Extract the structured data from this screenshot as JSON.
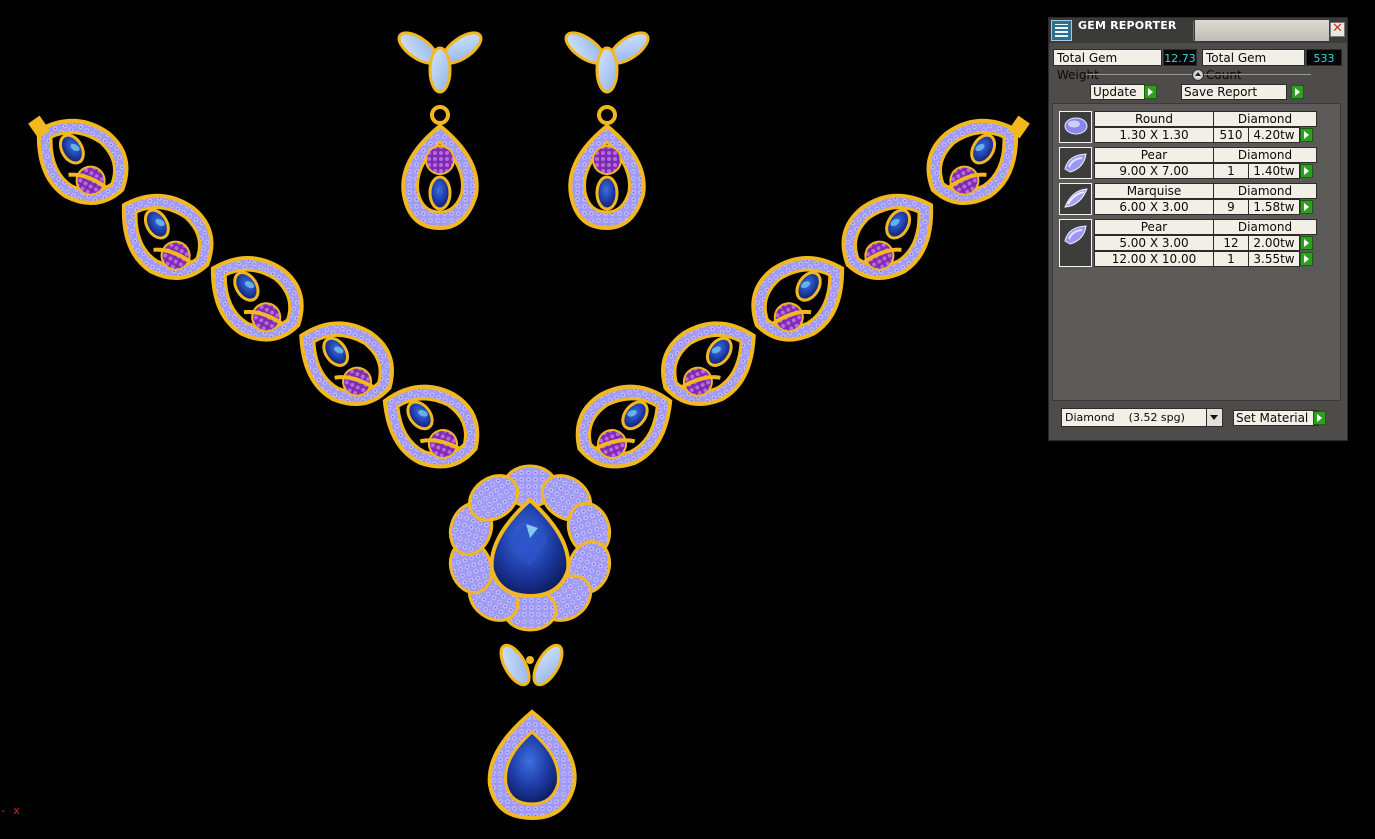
{
  "viewport": {
    "axis_label": "- x",
    "colors": {
      "background": "#000000",
      "gold": "#f2b81f",
      "gold_dark": "#c8870c",
      "pave": "#9b96f5",
      "pave_dot": "#7a27b0",
      "sapphire": "#1b3a9e",
      "sapphire_light": "#3f6dd6",
      "marquise": "#a9c8f3"
    }
  },
  "gem_reporter": {
    "title": "GEM REPORTER",
    "close_label": "✕",
    "total_weight_label": "Total Gem Weight",
    "total_weight_value": "12.73",
    "total_count_label": "Total Gem Count",
    "total_count_value": "533",
    "update_label": "Update",
    "save_report_label": "Save Report",
    "gems": [
      {
        "shape": "Round",
        "material": "Diamond",
        "icon": "round-gem-icon",
        "rows": [
          {
            "size": "1.30 X 1.30",
            "count": "510",
            "weight": "4.20tw"
          }
        ]
      },
      {
        "shape": "Pear",
        "material": "Diamond",
        "icon": "pear-gem-icon",
        "rows": [
          {
            "size": "9.00 X 7.00",
            "count": "1",
            "weight": "1.40tw"
          }
        ]
      },
      {
        "shape": "Marquise",
        "material": "Diamond",
        "icon": "marquise-gem-icon",
        "rows": [
          {
            "size": "6.00 X 3.00",
            "count": "9",
            "weight": "1.58tw"
          }
        ]
      },
      {
        "shape": "Pear",
        "material": "Diamond",
        "icon": "pear-gem-icon",
        "rows": [
          {
            "size": "5.00 X 3.00",
            "count": "12",
            "weight": "2.00tw"
          },
          {
            "size": "12.00 X 10.00",
            "count": "1",
            "weight": "3.55tw"
          }
        ]
      }
    ],
    "material_selected": "Diamond    (3.52 spg)",
    "set_material_label": "Set Material"
  }
}
